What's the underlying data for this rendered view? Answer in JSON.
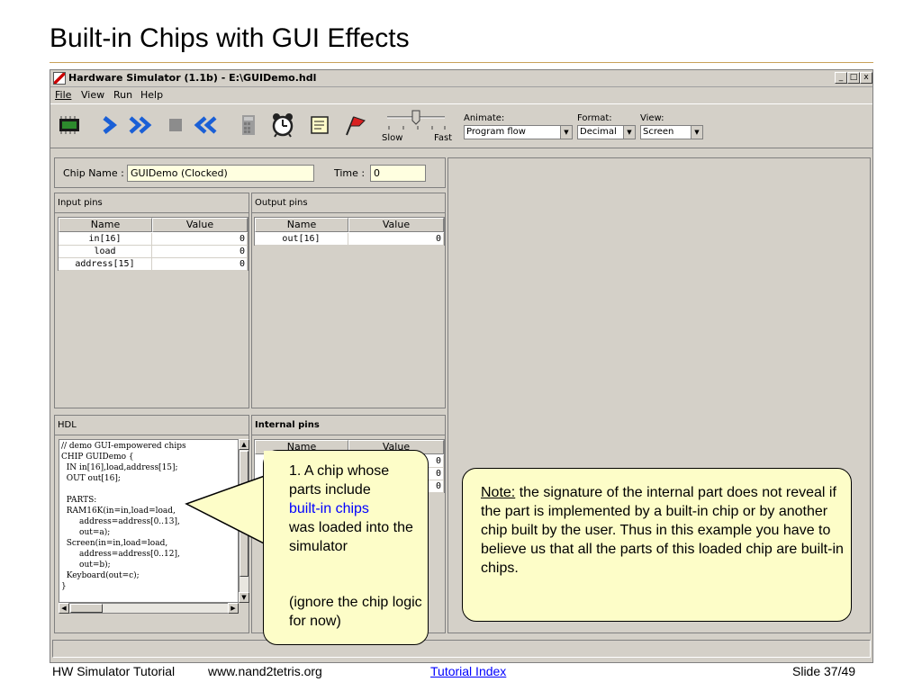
{
  "slide": {
    "title": "Built-in Chips with GUI Effects",
    "footer_left": "HW Simulator Tutorial",
    "footer_url": "www.nand2tetris.org",
    "footer_link": "Tutorial Index",
    "footer_right": "Slide 37/49"
  },
  "window": {
    "title": "Hardware Simulator (1.1b) - E:\\GUIDemo.hdl",
    "min": "_",
    "max": "□",
    "close": "x",
    "menu": [
      "File",
      "View",
      "Run",
      "Help"
    ]
  },
  "toolbar": {
    "slow_label": "Slow",
    "fast_label": "Fast",
    "animate_label": "Animate:",
    "animate_value": "Program flow",
    "format_label": "Format:",
    "format_value": "Decimal",
    "view_label": "View:",
    "view_value": "Screen"
  },
  "chip": {
    "name_label": "Chip Name :",
    "name_value": "GUIDemo (Clocked)",
    "time_label": "Time :",
    "time_value": "0"
  },
  "input_pins": {
    "title": "Input pins",
    "col_name": "Name",
    "col_value": "Value",
    "rows": [
      {
        "name": "in[16]",
        "value": "0"
      },
      {
        "name": "load",
        "value": "0"
      },
      {
        "name": "address[15]",
        "value": "0"
      }
    ]
  },
  "output_pins": {
    "title": "Output pins",
    "col_name": "Name",
    "col_value": "Value",
    "rows": [
      {
        "name": "out[16]",
        "value": "0"
      }
    ]
  },
  "hdl": {
    "title": "HDL",
    "code": "// demo GUI-empowered chips\nCHIP GUIDemo {\n  IN in[16],load,address[15];\n  OUT out[16];\n\n  PARTS:\n  RAM16K(in=in,load=load,\n       address=address[0..13],\n       out=a);\n  Screen(in=in,load=load,\n       address=address[0..12],\n       out=b);\n  Keyboard(out=c);\n}"
  },
  "internal_pins": {
    "title": "Internal pins",
    "col_name": "Name",
    "col_value": "Value",
    "values": [
      "0",
      "0",
      "0"
    ]
  },
  "callout1": {
    "line1": "1. A chip whose parts include",
    "link": "built-in chips",
    "line2": "was loaded into the simulator",
    "note": "(ignore the chip logic for now)"
  },
  "callout2": {
    "note_label": "Note:",
    "text": " the signature of the internal part does not reveal if the part is implemented by a built-in chip or by another chip built by the user. Thus in this example you have to believe us that all the parts of this loaded chip are built-in chips."
  },
  "colors": {
    "window_bg": "#d4d0c8",
    "field_bg": "#ffffe0",
    "callout_bg": "#fdfdc8",
    "link": "#0000ff",
    "arrow_blue": "#1a5fd6"
  },
  "icons": [
    "chip-icon",
    "step-icon",
    "fast-forward-icon",
    "stop-icon",
    "rewind-icon",
    "calculator-icon",
    "clock-icon",
    "script-icon",
    "breakpoint-flag-icon"
  ]
}
